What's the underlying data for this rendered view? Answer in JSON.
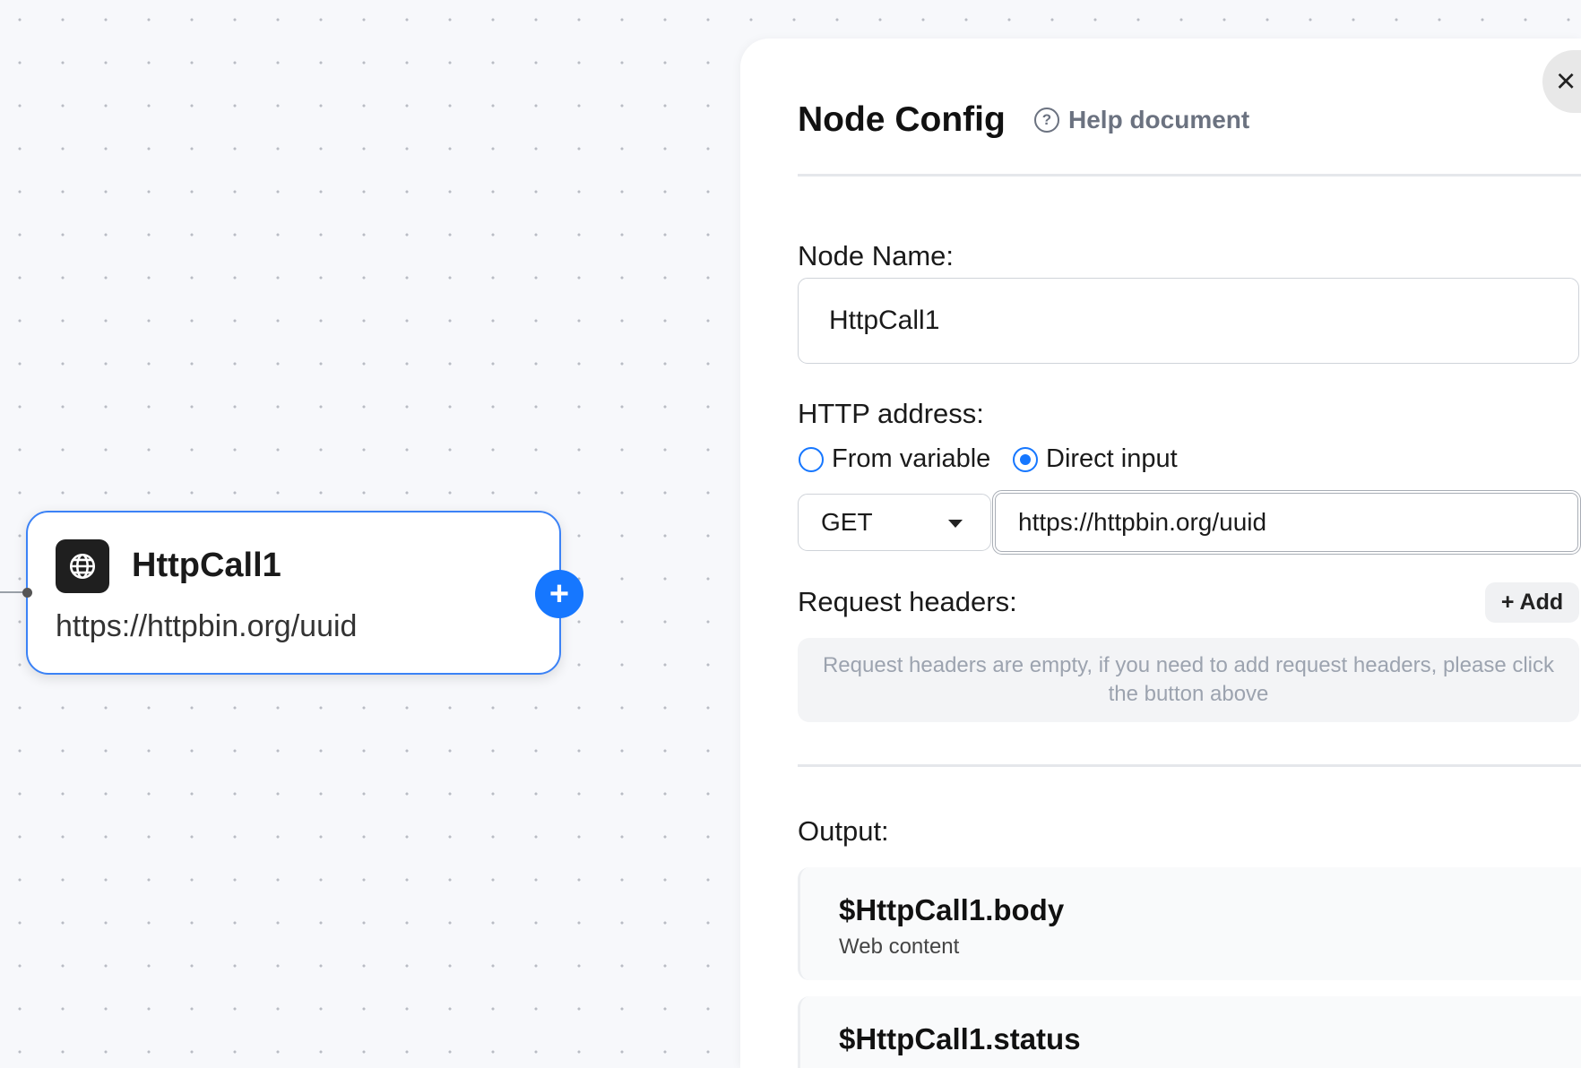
{
  "canvas": {
    "node": {
      "title": "HttpCall1",
      "url": "https://httpbin.org/uuid",
      "icon": "globe-icon",
      "add_label": "+"
    }
  },
  "panel": {
    "title": "Node Config",
    "help_label": "Help document",
    "close_label": "×",
    "node_name_label": "Node Name:",
    "node_name_value": "HttpCall1",
    "http_address_label": "HTTP address:",
    "radio_from_variable": "From variable",
    "radio_direct_input": "Direct input",
    "selected_radio": "Direct input",
    "method": "GET",
    "url_value": "https://httpbin.org/uuid",
    "request_headers_label": "Request headers:",
    "add_label": "+ Add",
    "headers_empty": "Request headers are empty, if you need to add request headers, please click the button above",
    "output_label": "Output:",
    "outputs": [
      {
        "name": "$HttpCall1.body",
        "desc": "Web content"
      },
      {
        "name": "$HttpCall1.status",
        "desc": ""
      }
    ]
  },
  "colors": {
    "accent": "#1677ff",
    "node_border": "#3b82f6"
  }
}
